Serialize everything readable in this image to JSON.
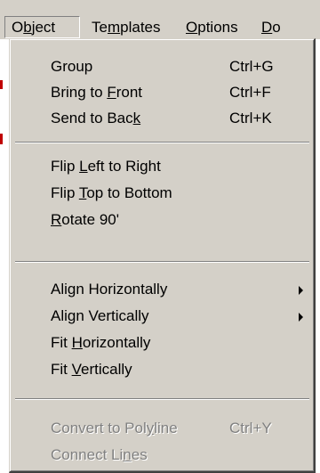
{
  "menubar": {
    "items": [
      {
        "label": "Object"
      },
      {
        "label": "Templates"
      },
      {
        "label": "Options"
      },
      {
        "label": "Do"
      }
    ]
  },
  "menu": {
    "group_label": "Group",
    "group_shortcut": "Ctrl+G",
    "bring_to_front_label": "Bring to Front",
    "bring_to_front_shortcut": "Ctrl+F",
    "send_to_back_label": "Send to Back",
    "send_to_back_shortcut": "Ctrl+K",
    "flip_left_right_label": "Flip Left to Right",
    "flip_top_bottom_label": "Flip Top to Bottom",
    "rotate_90_label": "Rotate 90'",
    "align_horizontally_label": "Align Horizontally",
    "align_vertically_label": "Align Vertically",
    "fit_horizontally_label": "Fit Horizontally",
    "fit_vertically_label": "Fit Vertically",
    "convert_to_polyline_label": "Convert to Polyline",
    "convert_to_polyline_shortcut": "Ctrl+Y",
    "connect_lines_label": "Connect Lines"
  }
}
